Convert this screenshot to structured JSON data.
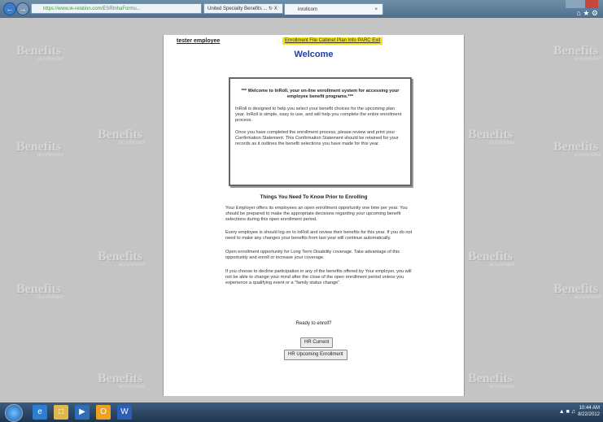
{
  "browser": {
    "url": "https://www.le-relation.com/ESRInhaFormu...",
    "address_tools": "United Specialty Benefits ... ↻ X",
    "tab_title": "inrollcom",
    "tab_close": "×",
    "back_glyph": "←",
    "forward_glyph": "→",
    "icons": [
      "home-icon",
      "star-icon",
      "gear-icon"
    ]
  },
  "background": {
    "watermark_logo": "Benefits",
    "watermark_tagline": "accelerator"
  },
  "page": {
    "user_name": "tester employee",
    "top_nav": "Enrollment File Cabinet Plan Info PARC Exit",
    "title": "Welcome",
    "welcome_heading": "*** Welcome to InRoll, your on-line enrollment system for accessing your employee benefit programs.***",
    "welcome_p1": "InRoll is designed to help you select your benefit choices for the upcoming plan year. InRoll is simple, easy to use, and will help you complete the entire enrollment process.",
    "welcome_p2": "Once you have completed the enrollment process, please review and print your Confirmation Statement. This Confirmation Statement should be retained for your records as it outlines the benefit selections you have made for this year.",
    "section_title": "Things You Need To Know Prior to Enrolling",
    "paragraphs": [
      "Your Employer offers its employees an open enrollment opportunity one time per year. You should be prepared to make the appropriate decisions regarding your upcoming benefit selections during this open enrollment period.",
      "Every employee is should log on to InRoll and review their benefits for this year. If you do not need to make any changes your benefits from last year will continue automatically.",
      "Open enrollment opportunity for Long Term Disability coverage. Take advantage of this opportunity and enroll or increase your coverage.",
      "If you choose to decline participation in any of the benefits offered by Your employer, you will not be able to change your mind after the close of the open enrollment period unless you experience a qualifying event or a \"family status change\"."
    ],
    "ready_text": "Ready to enroll?",
    "btn_current": "HR Current",
    "btn_upcoming": "HR Upcoming Enrollment"
  },
  "taskbar": {
    "time": "10:44 AM",
    "date": "8/22/2012",
    "apps": [
      "ie-icon",
      "folder-icon",
      "media-icon",
      "outlook-icon",
      "word-icon"
    ]
  }
}
